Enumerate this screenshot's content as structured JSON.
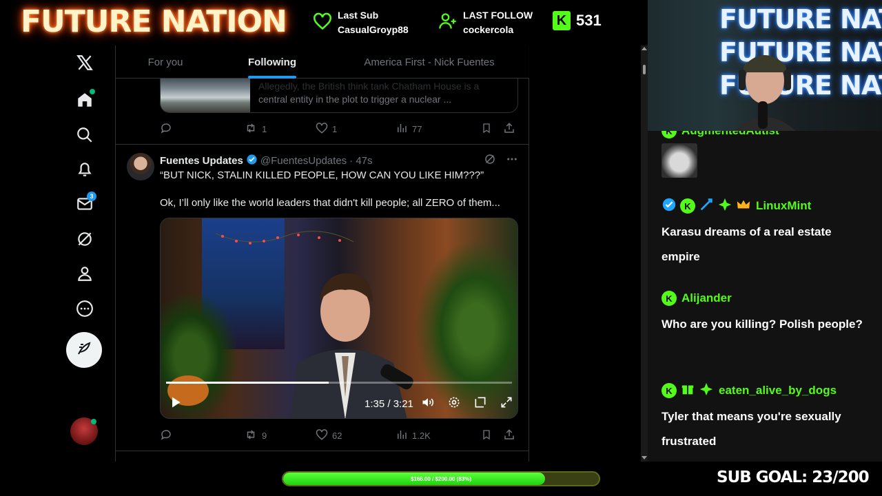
{
  "overlay": {
    "brand": "FUTURE NATION",
    "last_sub_label": "Last Sub",
    "last_sub_user": "CasualGroyp88",
    "last_follow_label": "LAST FOLLOW",
    "last_follow_user": "cockercola",
    "kick_logo": "K",
    "kick_viewers": "531",
    "sub_goal_text": "SUB GOAL: 23/200",
    "goal_bar_text": "$166.00 / $200.00 (83%)",
    "goal_bar_progress": 0.83,
    "accent_green": "#53fc18"
  },
  "x": {
    "tabs": [
      {
        "label": "For you",
        "active": false
      },
      {
        "label": "Following",
        "active": true
      },
      {
        "label": "America First - Nick Fuentes",
        "active": false
      }
    ],
    "nav": [
      "x-logo-icon",
      "home-icon",
      "search-icon",
      "notifications-icon",
      "messages-icon",
      "grok-icon",
      "profile-icon",
      "more-icon",
      "post-icon"
    ],
    "messages_badge": "3",
    "prev_tweet": {
      "card_text_line1": "Allegedly, the British think tank Chatham House is a",
      "card_text_line2": "central entity in the plot to trigger a nuclear ...",
      "replies": "",
      "reposts": "1",
      "likes": "1",
      "views": "77"
    },
    "tweet": {
      "name": "Fuentes Updates",
      "handle": "@FuentesUpdates",
      "time": "· 47s",
      "text1": "“BUT NICK, STALIN KILLED PEOPLE, HOW CAN YOU LIKE HIM???”",
      "text2": "Ok, I’ll only like the world leaders that didn't kill people; all ZERO of them...",
      "video_time": "1:35 / 3:21",
      "video_progress": 0.47,
      "replies": "",
      "reposts": "9",
      "likes": "62",
      "views": "1.2K"
    },
    "brand_blue": "#1d9bf0"
  },
  "cam": {
    "neon1": "FUTURE NATION",
    "neon2": "FUTURE NATION",
    "neon3": "FUTURE NATION"
  },
  "chat": {
    "messages": [
      {
        "user": "AugmentedAutist",
        "text": ""
      },
      {
        "user": "LinuxMint",
        "text": "Karasu dreams of a real estate empire"
      },
      {
        "user": "Alijander",
        "text": "Who are you killing? Polish people?"
      },
      {
        "user": "eaten_alive_by_dogs",
        "text": "Tyler that means you're sexually frustrated"
      }
    ]
  }
}
